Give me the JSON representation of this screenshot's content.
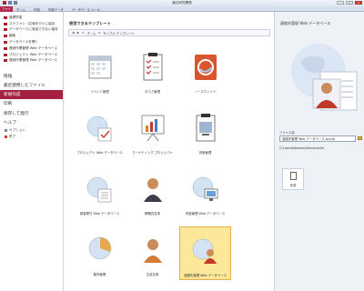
{
  "titlebar": {
    "title": "論文研究開発",
    "controls": [
      "–",
      "□",
      "×"
    ]
  },
  "ribbon": {
    "file_tab": "ファイル",
    "tabs": [
      "ホーム",
      "作成",
      "外部データ",
      "データベース ツール"
    ]
  },
  "sidebar": {
    "recent_databases": [
      "論理学習",
      "ステファン（広域を行うに保存",
      "データベースに追加できない保存",
      "顧客",
      "データベースを開く",
      "連続作業管理 Web データベース",
      "プロジェクト Web データベース",
      "連続作業管理 Web データベース"
    ],
    "menu": [
      {
        "label": "情報",
        "active": false
      },
      {
        "label": "最近使用したファイル",
        "active": false
      },
      {
        "label": "新規作成",
        "active": true
      },
      {
        "label": "印刷",
        "active": false
      },
      {
        "label": "保存して発行",
        "active": false
      },
      {
        "label": "ヘルプ",
        "active": false
      }
    ],
    "sub": [
      {
        "label": "オプション",
        "icon": "options-icon"
      },
      {
        "label": "終了",
        "icon": "exit-icon"
      }
    ]
  },
  "main": {
    "section_title": "使用できるテンプレート",
    "breadcrumb": {
      "back": "◀",
      "forward": "▶",
      "home": "ホーム",
      "separator": "▸",
      "current": "サンプル テンプレート"
    },
    "templates": [
      {
        "label": "イベント管理",
        "icon": "calendar-icon",
        "selected": false
      },
      {
        "label": "タスク管理",
        "icon": "clipboard-icon",
        "selected": false
      },
      {
        "label": "ノースウィンド",
        "icon": "northwind-icon",
        "selected": false
      },
      {
        "label": "プロジェクト Web データベース",
        "icon": "project-web-icon",
        "selected": false
      },
      {
        "label": "マーケティング プロジェクト",
        "icon": "chart-board-icon",
        "selected": false
      },
      {
        "label": "資産管理",
        "icon": "asset-clipboard-icon",
        "selected": false
      },
      {
        "label": "慈善寄付 Web データベース",
        "icon": "charity-web-icon",
        "selected": false
      },
      {
        "label": "教職員名簿",
        "icon": "faculty-icon",
        "selected": false
      },
      {
        "label": "資産管理 Web データベース",
        "icon": "asset-web-icon",
        "selected": false
      },
      {
        "label": "販売管理",
        "icon": "sales-icon",
        "selected": false
      },
      {
        "label": "生徒名簿",
        "icon": "students-icon",
        "selected": false
      },
      {
        "label": "連絡先管理 Web データベース",
        "icon": "contacts-web-icon",
        "selected": true
      }
    ]
  },
  "right_panel": {
    "title": "連絡先管理 Web データベース",
    "file_name_label": "ファイル名",
    "file_name_value": "連絡先管理 Web データベース.accdb",
    "path": "C:\\Users\\k6komen\\Documents\\",
    "create_label": "作成"
  },
  "colors": {
    "accent": "#a4213f",
    "selected_tile": "#fde799"
  }
}
